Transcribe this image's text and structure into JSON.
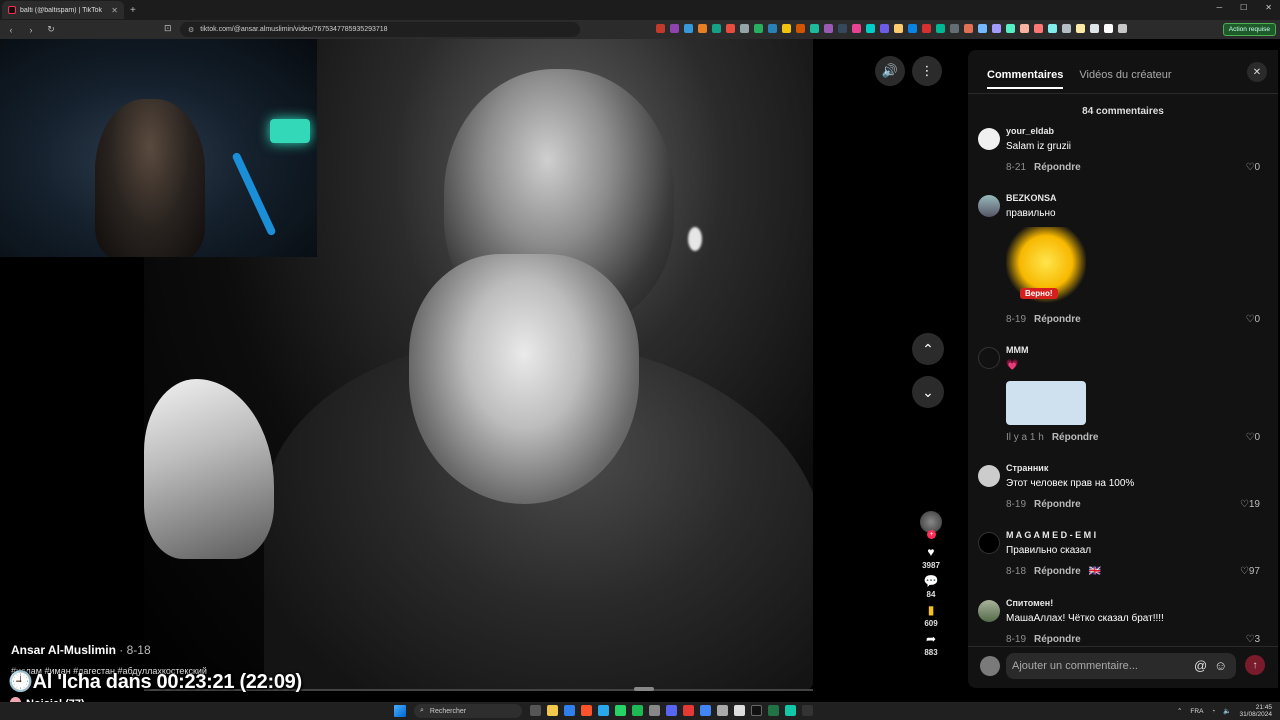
{
  "browser": {
    "tab_title": "balti (@baltispam) | TikTok",
    "new_tab": "+",
    "url": "tiktok.com/@ansar.almuslimin/video/7675347785935293718",
    "action_button": "Action requise"
  },
  "video": {
    "author": "Ansar Al-Muslimin",
    "date": "8-18",
    "hashtags": "#ислам #иман #дагестан #абдуллахкостекский",
    "likes": "3987",
    "comments": "84",
    "saves": "609",
    "shares": "883"
  },
  "stream_overlay": {
    "prayer_text": "Al 'Icha dans 00:23:21 (22:09)",
    "viewer_text": "Noisiel (77)"
  },
  "panel": {
    "tabs": [
      "Commentaires",
      "Vidéos du créateur"
    ],
    "count": "84 commentaires",
    "reply_label": "Répondre",
    "comments": [
      {
        "user": "your_eldab",
        "text": "Salam iz gruzii",
        "date": "8-21",
        "likes": "0"
      },
      {
        "user": "BEZKONSA",
        "text": "правильно",
        "sticker_label": "Верно!",
        "date": "8-19",
        "likes": "0"
      },
      {
        "user": "MMM",
        "text": "💗",
        "date": "Il y a 1 h",
        "likes": "0"
      },
      {
        "user": "Странник",
        "text": "Этот человек прав на 100%",
        "date": "8-19",
        "likes": "19"
      },
      {
        "user": "M A G A M E D - E M I",
        "text": "Правильно сказал",
        "date": "8-18",
        "likes": "97"
      },
      {
        "user": "Спитомен!",
        "text": "МашаАллах! Чётко сказал брат!!!!",
        "date": "8-19",
        "likes": "3"
      }
    ],
    "compose_placeholder": "Ajouter un commentaire..."
  },
  "taskbar": {
    "search_placeholder": "Rechercher",
    "lang": "FRA",
    "time": "21:45",
    "date": "31/08/2024"
  }
}
